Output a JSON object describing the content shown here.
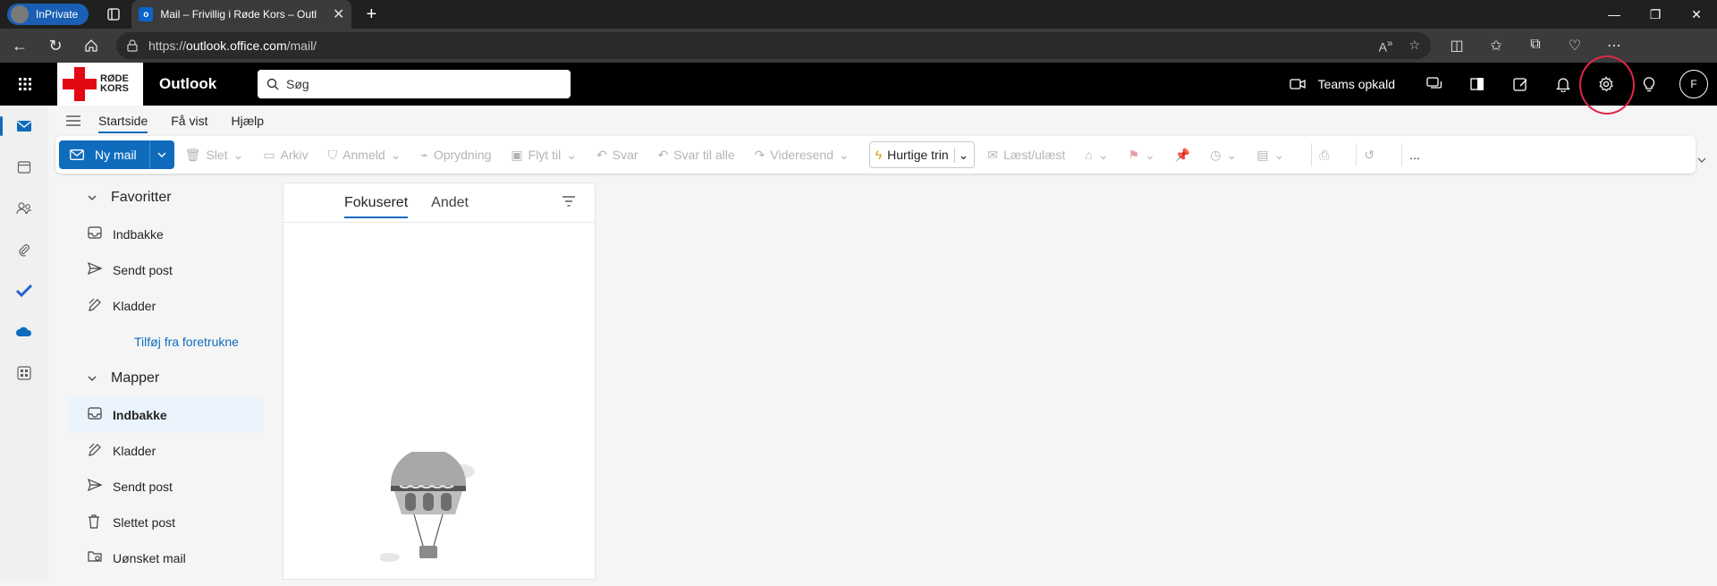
{
  "browser": {
    "inprivate_label": "InPrivate",
    "tab_title": "Mail – Frivillig i Røde Kors – Outl",
    "url_prefix": "https://",
    "url_host": "outlook.office.com",
    "url_path": "/mail/"
  },
  "header": {
    "logo_line1": "RØDE",
    "logo_line2": "KORS",
    "app_name": "Outlook",
    "search_placeholder": "Søg",
    "teams_call": "Teams opkald",
    "avatar_initial": "F"
  },
  "ribbon": {
    "tabs": [
      "Startside",
      "Få vist",
      "Hjælp"
    ],
    "new_mail": "Ny mail",
    "actions": {
      "delete": "Slet",
      "archive": "Arkiv",
      "report": "Anmeld",
      "sweep": "Oprydning",
      "move": "Flyt til",
      "reply": "Svar",
      "reply_all": "Svar til alle",
      "forward": "Videresend",
      "quick_steps": "Hurtige trin",
      "read_unread": "Læst/ulæst"
    },
    "more": "..."
  },
  "folders": {
    "favorites_title": "Favoritter",
    "favorites": [
      "Indbakke",
      "Sendt post",
      "Kladder"
    ],
    "add_favorite": "Tilføj fra foretrukne",
    "folders_title": "Mapper",
    "items": [
      "Indbakke",
      "Kladder",
      "Sendt post",
      "Slettet post",
      "Uønsket mail"
    ]
  },
  "message_list": {
    "tab_focused": "Fokuseret",
    "tab_other": "Andet"
  },
  "colors": {
    "accent": "#0f6cbd",
    "annotation": "#e0264a",
    "redcross": "#e30613"
  }
}
